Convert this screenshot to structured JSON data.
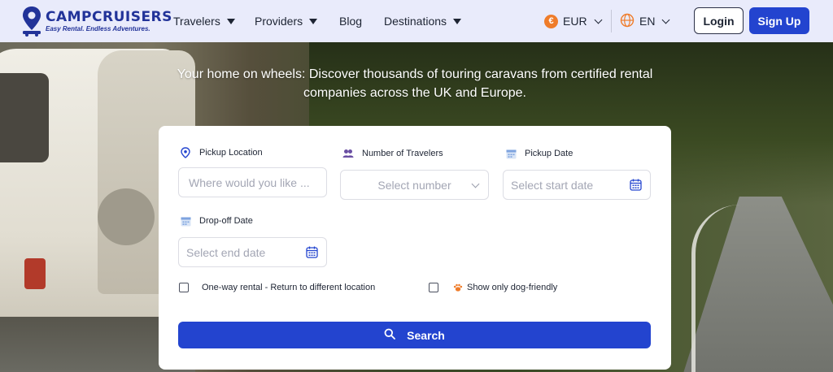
{
  "brand": {
    "name": "CAMPCRUISERS",
    "tagline": "Easy Rental. Endless Adventures.",
    "color": "#223399"
  },
  "nav": {
    "travelers": "Travelers",
    "providers": "Providers",
    "blog": "Blog",
    "destinations": "Destinations"
  },
  "currency": {
    "symbol": "€",
    "label": "EUR",
    "icon": "euro-coin-icon",
    "color": "#ef7c2a"
  },
  "language": {
    "label": "EN",
    "icon": "globe-icon"
  },
  "auth": {
    "login": "Login",
    "signup": "Sign Up"
  },
  "hero": {
    "line1": "Your home on wheels: Discover thousands of touring caravans from certified rental",
    "line2": "companies across the UK and Europe."
  },
  "search": {
    "pickup_location": {
      "label": "Pickup Location",
      "placeholder": "Where would you like ...",
      "icon": "location-pin-icon"
    },
    "travelers": {
      "label": "Number of Travelers",
      "placeholder": "Select number",
      "icon": "users-icon"
    },
    "pickup_date": {
      "label": "Pickup Date",
      "placeholder": "Select start date",
      "icon": "calendar-icon"
    },
    "dropoff_date": {
      "label": "Drop-off Date",
      "placeholder": "Select end date",
      "icon": "calendar-icon"
    },
    "one_way": {
      "label": "One-way rental - Return to different location",
      "checked": false
    },
    "dog_friendly": {
      "label": "Show only dog-friendly",
      "icon": "dog-icon",
      "checked": false
    },
    "button": "Search"
  },
  "colors": {
    "primary": "#2344cf",
    "header_bg": "#e9ebfb",
    "text": "#1d2433",
    "placeholder": "#a3a6b4"
  }
}
